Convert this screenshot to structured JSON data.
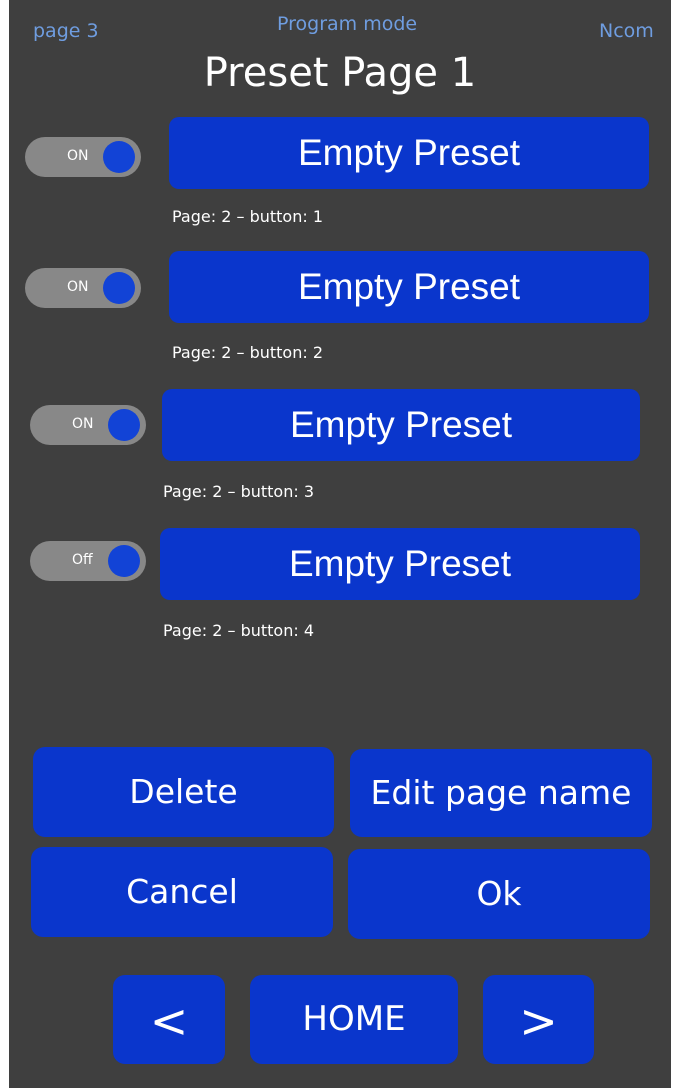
{
  "header": {
    "page_label": "page 3",
    "mode_label": "Program mode",
    "brand_label": "Ncom",
    "title": "Preset Page 1"
  },
  "presets": [
    {
      "toggle_label": "ON",
      "button_label": "Empty Preset",
      "caption": "Page: 2 – button: 1"
    },
    {
      "toggle_label": "ON",
      "button_label": "Empty Preset",
      "caption": "Page: 2 – button: 2"
    },
    {
      "toggle_label": "ON",
      "button_label": "Empty Preset",
      "caption": "Page: 2 – button: 3"
    },
    {
      "toggle_label": "Off",
      "button_label": "Empty Preset",
      "caption": "Page: 2 – button: 4"
    }
  ],
  "actions": {
    "delete_label": "Delete",
    "edit_page_name_label": "Edit page name",
    "cancel_label": "Cancel",
    "ok_label": "Ok"
  },
  "nav": {
    "prev_label": "<",
    "home_label": "HOME",
    "next_label": ">"
  },
  "colors": {
    "background": "#3f3f3f",
    "button": "#0a36cc",
    "toggle_track": "#888888",
    "toggle_knob": "#1243d6",
    "header_text": "#6f9de0"
  }
}
